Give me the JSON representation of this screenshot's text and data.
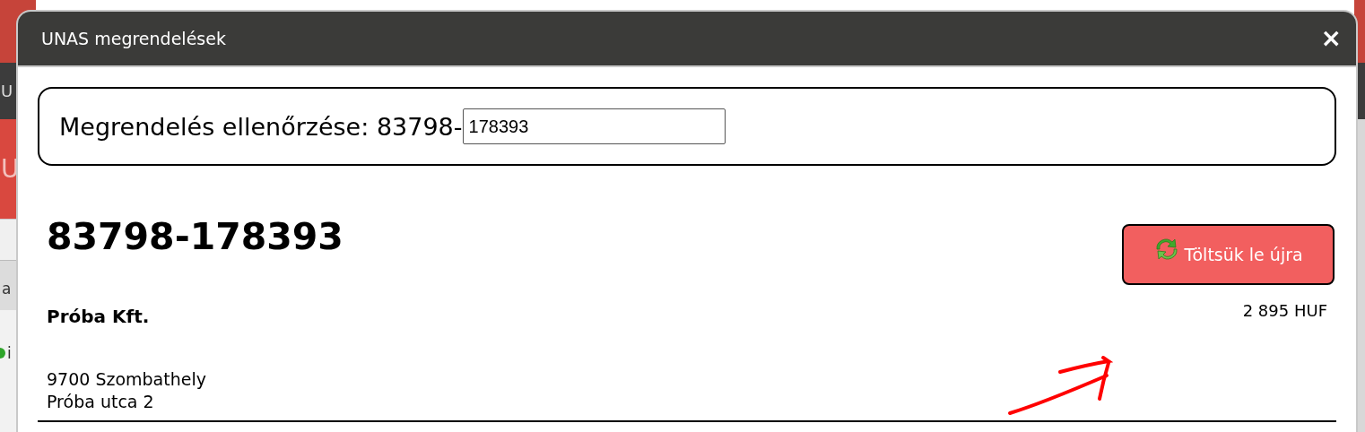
{
  "background_page": {
    "texts": [
      "U",
      "U",
      "a",
      "i"
    ]
  },
  "window": {
    "title": "UNAS megrendelések",
    "close": "×"
  },
  "check": {
    "label": "Megrendelés ellenőrzése: 83798-",
    "value": "178393"
  },
  "order": {
    "number": "83798-178393",
    "reload_button": "Töltsük le újra",
    "customer": "Próba Kft.",
    "total": "2 895 HUF",
    "address": [
      "9700 Szombathely",
      "Próba utca 2"
    ]
  }
}
